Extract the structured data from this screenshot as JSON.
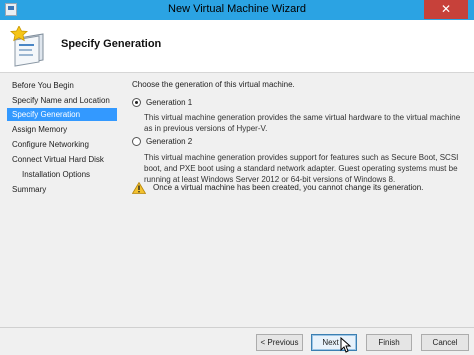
{
  "window": {
    "title": "New Virtual Machine Wizard",
    "close_glyph": "✕"
  },
  "header": {
    "title": "Specify Generation",
    "icon": "wizard-page-icon"
  },
  "sidebar": {
    "items": [
      {
        "label": "Before You Begin",
        "active": false
      },
      {
        "label": "Specify Name and Location",
        "active": false
      },
      {
        "label": "Specify Generation",
        "active": true
      },
      {
        "label": "Assign Memory",
        "active": false
      },
      {
        "label": "Configure Networking",
        "active": false
      },
      {
        "label": "Connect Virtual Hard Disk",
        "active": false
      },
      {
        "label": "Installation Options",
        "active": false,
        "sub": true
      },
      {
        "label": "Summary",
        "active": false
      }
    ]
  },
  "main": {
    "intro": "Choose the generation of this virtual machine.",
    "options": [
      {
        "label": "Generation 1",
        "selected": true,
        "description": "This virtual machine generation provides the same virtual hardware to the virtual machine as in previous versions of Hyper-V."
      },
      {
        "label": "Generation 2",
        "selected": false,
        "description": "This virtual machine generation provides support for features such as Secure Boot, SCSI boot, and PXE boot using a standard network adapter. Guest operating systems must be running at least Windows Server 2012 or 64-bit versions of Windows 8."
      }
    ],
    "warning": "Once a virtual machine has been created, you cannot change its generation."
  },
  "buttons": {
    "previous": "< Previous",
    "next": "Next >",
    "finish": "Finish",
    "cancel": "Cancel"
  },
  "colors": {
    "titlebar": "#2ba3e3",
    "close": "#c7413a",
    "selection": "#3399ff",
    "warning": "#f2c12e"
  }
}
